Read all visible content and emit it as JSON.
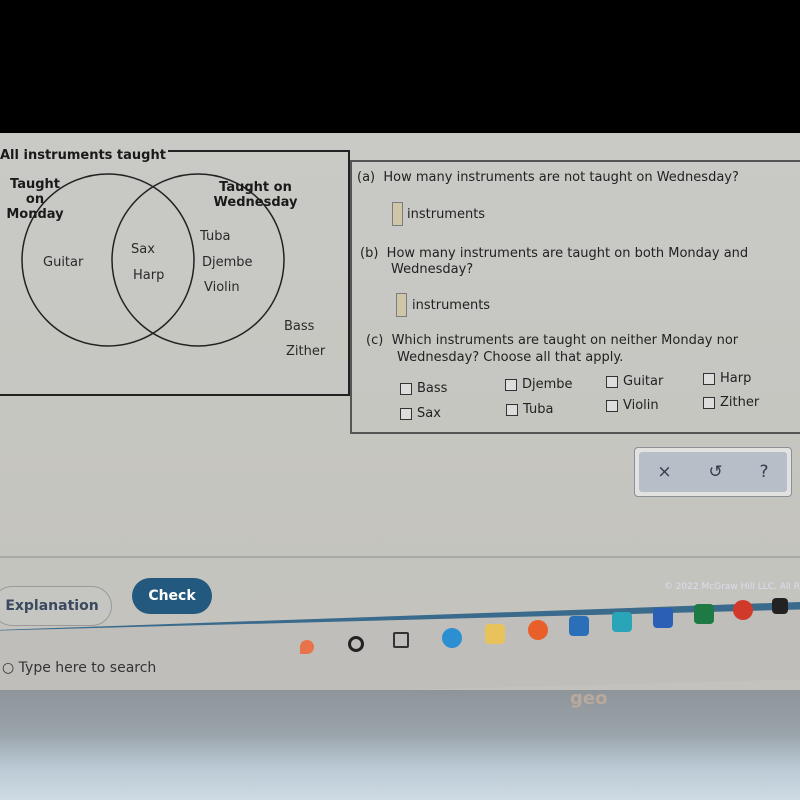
{
  "venn": {
    "title": "All instruments taught",
    "set_a_label_line1": "Taught on",
    "set_a_label_line2": "Monday",
    "set_b_label_line1": "Taught on",
    "set_b_label_line2": "Wednesday",
    "only_monday": [
      "Guitar"
    ],
    "both": [
      "Sax",
      "Harp"
    ],
    "only_wednesday": [
      "Tuba",
      "Djembe",
      "Violin"
    ],
    "neither": [
      "Bass",
      "Zither"
    ]
  },
  "questions": {
    "a": {
      "label": "(a)",
      "text": "How many instruments are not taught on Wednesday?",
      "answer_value": "",
      "unit": "instruments"
    },
    "b": {
      "label": "(b)",
      "text_line1": "How many instruments are taught on both Monday and",
      "text_line2": "Wednesday?",
      "answer_value": "",
      "unit": "instruments"
    },
    "c": {
      "label": "(c)",
      "text_line1": "Which instruments are taught on neither Monday nor",
      "text_line2": "Wednesday? Choose all that apply.",
      "options": [
        {
          "label": "Bass",
          "checked": false
        },
        {
          "label": "Djembe",
          "checked": false
        },
        {
          "label": "Guitar",
          "checked": false
        },
        {
          "label": "Harp",
          "checked": false
        },
        {
          "label": "Sax",
          "checked": false
        },
        {
          "label": "Tuba",
          "checked": false
        },
        {
          "label": "Violin",
          "checked": false
        },
        {
          "label": "Zither",
          "checked": false
        }
      ]
    }
  },
  "toolbar": {
    "clear": "×",
    "undo": "↺",
    "help": "?"
  },
  "buttons": {
    "explanation": "Explanation",
    "check": "Check"
  },
  "footer": {
    "copyright": "© 2022 McGraw Hill LLC. All R"
  },
  "taskbar": {
    "search_placeholder": "Type here to search"
  },
  "laptop": {
    "brand": "geo"
  }
}
